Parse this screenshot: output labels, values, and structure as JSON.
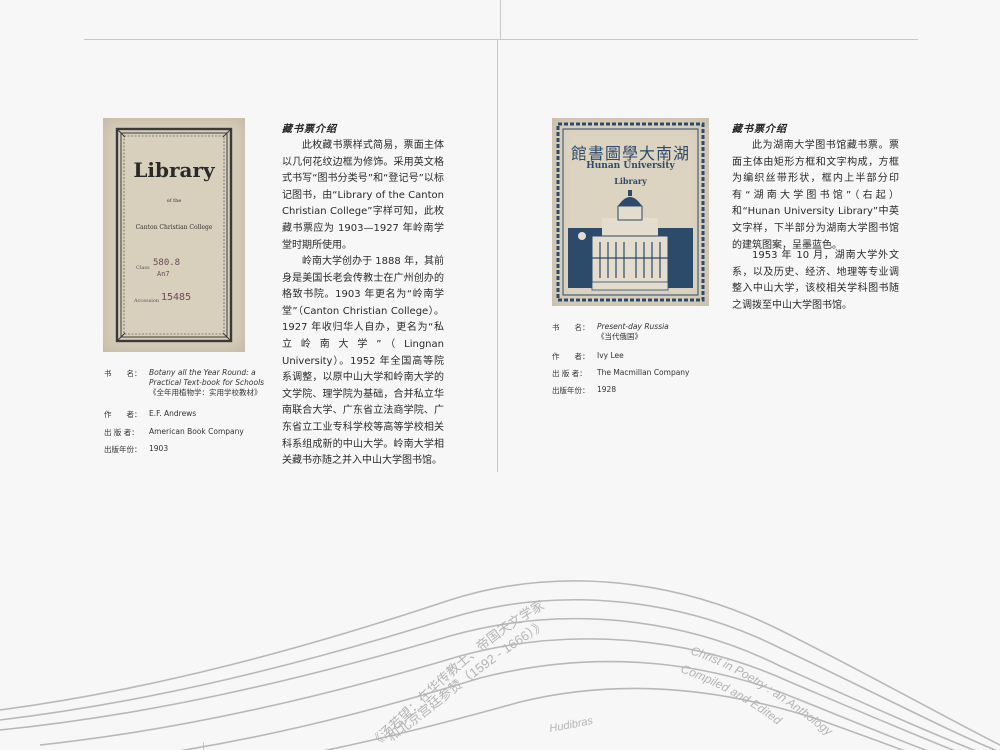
{
  "left": {
    "section_title": "藏书票介绍",
    "paragraphs": [
      "此枚藏书票样式简易，票面主体以几何花纹边框为修饰。采用英文格式书写“图书分类号”和“登记号”以标记图书，由“Library of the Canton Christian College”字样可知，此枚藏书票应为 1903—1927 年岭南学堂时期所使用。",
      "岭南大学创办于 1888 年，其前身是美国长老会传教士在广州创办的格致书院。1903 年更名为“岭南学堂”（Canton Christian College）。1927 年收归华人自办，更名为“私立岭南大学”（Lingnan University）。1952 年全国高等院系调整，以原中山大学和岭南大学的文学院、理学院为基础，合并私立华南联合大学、广东省立法商学院、广东省立工业专科学校等高等学校相关科系组成新的中山大学。岭南大学相关藏书亦随之并入中山大学图书馆。"
    ],
    "bookplate": {
      "title": "Library",
      "of": "of the",
      "college": "Canton Christian College",
      "class_label": "Class",
      "class_value": "580.8",
      "class_sub": "An7",
      "acc_label": "Accession",
      "acc_value": "15485"
    },
    "meta": [
      {
        "key": "书　　名：",
        "value": "Botany all the Year Round: a Practical Text-book for Schools",
        "sub": "《全年用植物学：实用学校教材》"
      },
      {
        "key": "作　　者：",
        "value": "E.F. Andrews"
      },
      {
        "key": "出 版 者：",
        "value": "American Book Company"
      },
      {
        "key": "出版年份：",
        "value": "1903"
      }
    ]
  },
  "right": {
    "section_title": "藏书票介绍",
    "paragraphs": [
      "此为湖南大学图书馆藏书票。票面主体由矩形方框和文字构成，方框为编织丝带形状，框内上半部分印有“湖南大学图书馆”（右起）和“Hunan University Library”中英文字样，下半部分为湖南大学图书馆的建筑图案，呈墨蓝色。",
      "1953 年 10 月，湖南大学外文系，以及历史、经济、地理等专业调整入中山大学，该校相关学科图书随之调拨至中山大学图书馆。"
    ],
    "bookplate": {
      "chinese": "館書圖學大南湖",
      "line1": "Hunan University",
      "line2": "Library"
    },
    "meta": [
      {
        "key": "书　　名：",
        "value": "Present-day Russia",
        "sub": "《当代俄国》"
      },
      {
        "key": "作　　者：",
        "value": "Ivy Lee"
      },
      {
        "key": "出 版 者：",
        "value": "The Macmillan Company"
      },
      {
        "key": "出版年份：",
        "value": "1928"
      }
    ]
  },
  "decoration": {
    "curve_text_1": "《汤若望：在华传教士、帝国天文学家",
    "curve_text_2": "和北京宫廷参赞（1592 - 1666）》",
    "curve_text_3": "Hudibras",
    "curve_text_4": "Christ in Poetry : an Anthology",
    "curve_text_5": "Compiled and Edited"
  },
  "colors": {
    "background": "#f7f7f7",
    "rule": "#c8c8c8",
    "plate_blue": "#2c4a6a",
    "plate_paper": "#d8cfbd"
  }
}
